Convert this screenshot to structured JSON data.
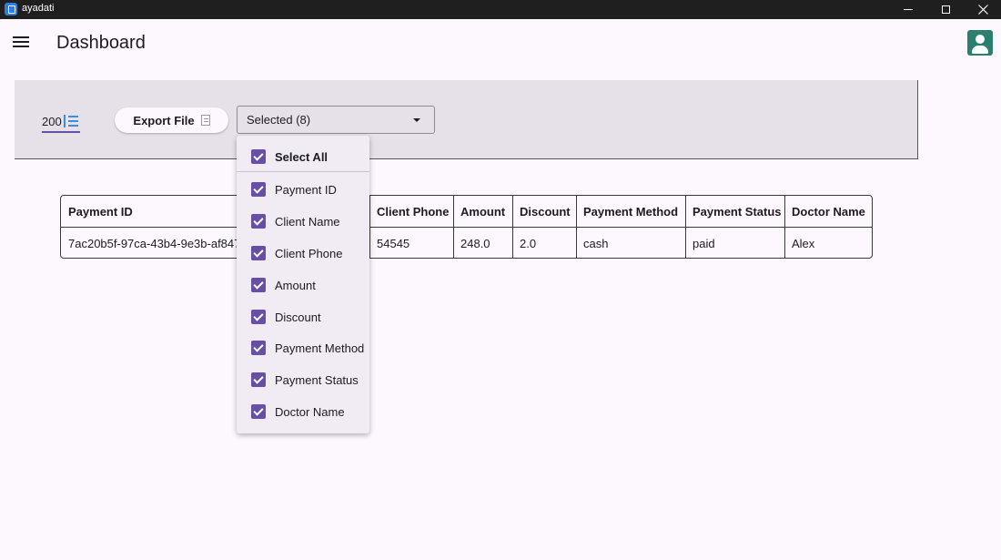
{
  "window": {
    "title": "ayadati"
  },
  "header": {
    "title": "Dashboard"
  },
  "toolbar": {
    "rows_per_page": "200",
    "export_label": "Export File",
    "column_select_label": "Selected (8)"
  },
  "dropdown": {
    "select_all_label": "Select All",
    "select_all_checked": true,
    "options": [
      {
        "label": "Payment ID",
        "checked": true
      },
      {
        "label": "Client Name",
        "checked": true
      },
      {
        "label": "Client Phone",
        "checked": true
      },
      {
        "label": "Amount",
        "checked": true
      },
      {
        "label": "Discount",
        "checked": true
      },
      {
        "label": "Payment Method",
        "checked": true
      },
      {
        "label": "Payment Status",
        "checked": true
      },
      {
        "label": "Doctor Name",
        "checked": true
      }
    ]
  },
  "table": {
    "headers": [
      "Payment ID",
      "Client Phone",
      "Amount",
      "Discount",
      "Payment Method",
      "Payment Status",
      "Doctor Name"
    ],
    "rows": [
      [
        "7ac20b5f-97ca-43b4-9e3b-af8479",
        "54545",
        "248.0",
        "2.0",
        "cash",
        "paid",
        "Alex"
      ]
    ]
  },
  "colors": {
    "accent": "#6750a4",
    "panel": "#e6e1e8",
    "background": "#fdf7fe",
    "avatar": "#2b7f6e",
    "rows_icon": "#3a8ee6"
  },
  "icons": {
    "menu": "menu-icon",
    "user": "account-icon",
    "sort": "sort-list-icon",
    "export": "document-icon",
    "caret": "caret-down-icon",
    "checkbox": "checkbox-checked-icon"
  }
}
